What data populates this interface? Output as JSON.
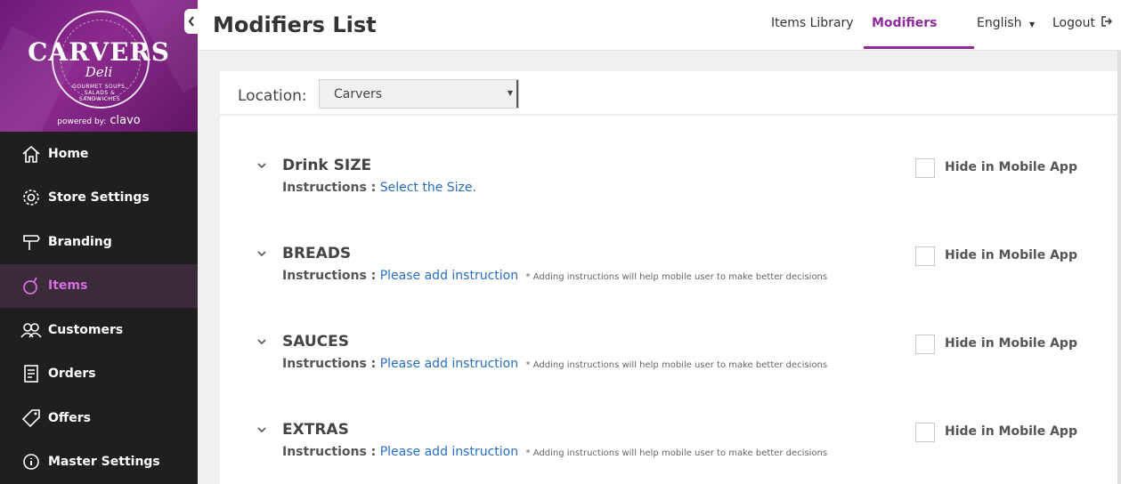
{
  "brand": {
    "title": "CARVERS",
    "subtitle": "Deli",
    "tagline": "GOURMET SOUPS, SALADS & SANDWICHES",
    "powered_by": "powered by:",
    "powered_name": "clavo",
    "accent": "#8e2a9c"
  },
  "sidebar": {
    "items": [
      {
        "label": "Home",
        "icon": "home-icon"
      },
      {
        "label": "Store Settings",
        "icon": "gear-icon"
      },
      {
        "label": "Branding",
        "icon": "signpost-icon"
      },
      {
        "label": "Items",
        "icon": "apple-icon"
      },
      {
        "label": "Customers",
        "icon": "users-icon"
      },
      {
        "label": "Orders",
        "icon": "receipt-icon"
      },
      {
        "label": "Offers",
        "icon": "tag-icon"
      },
      {
        "label": "Master Settings",
        "icon": "info-icon"
      }
    ]
  },
  "header": {
    "title": "Modifiers List",
    "nav": {
      "items_library": "Items Library",
      "modifiers": "Modifiers",
      "language": "English",
      "logout": "Logout"
    }
  },
  "location": {
    "label": "Location:",
    "selected": "Carvers"
  },
  "modifiers": [
    {
      "name": "Drink SIZE",
      "instructions_label": "Instructions :",
      "instruction": "Select the Size.",
      "note": "",
      "hide_label": "Hide in Mobile App"
    },
    {
      "name": "BREADS",
      "instructions_label": "Instructions :",
      "instruction": "Please add instruction",
      "note": "* Adding instructions will help mobile user to make better decisions",
      "hide_label": "Hide in Mobile App"
    },
    {
      "name": "SAUCES",
      "instructions_label": "Instructions :",
      "instruction": "Please add instruction",
      "note": "* Adding instructions will help mobile user to make better decisions",
      "hide_label": "Hide in Mobile App"
    },
    {
      "name": "EXTRAS",
      "instructions_label": "Instructions :",
      "instruction": "Please add instruction",
      "note": "* Adding instructions will help mobile user to make better decisions",
      "hide_label": "Hide in Mobile App"
    }
  ]
}
